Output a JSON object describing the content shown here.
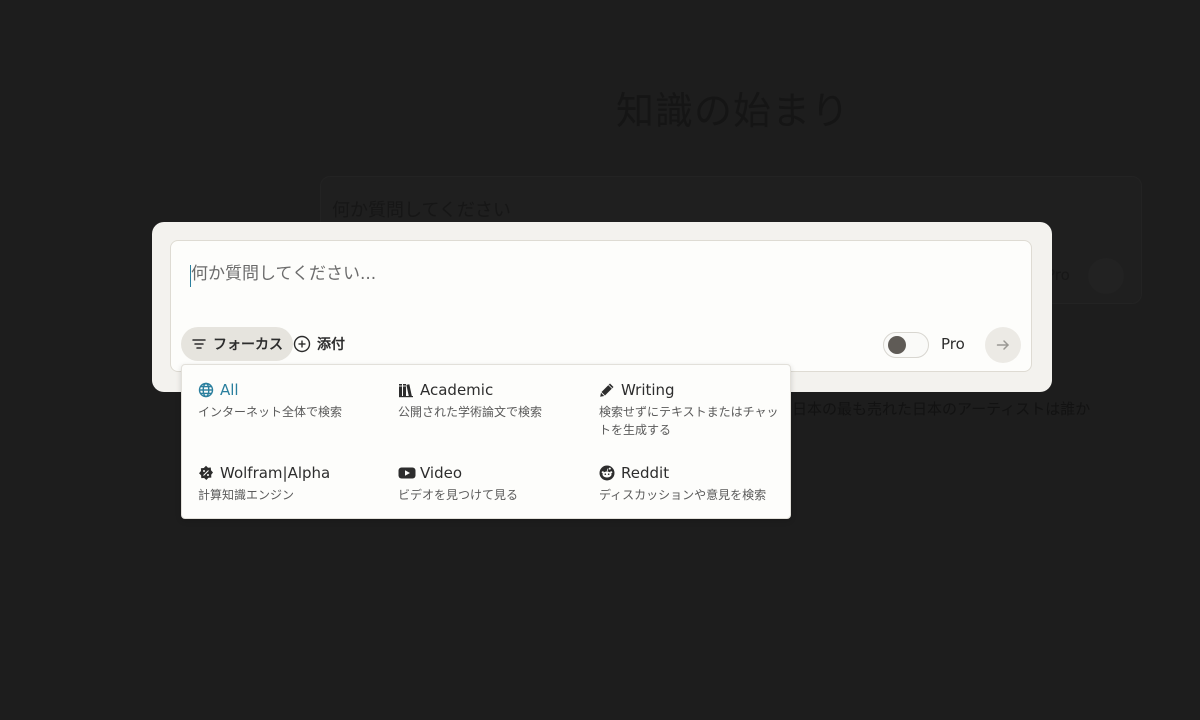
{
  "background": {
    "title": "知識の始まり",
    "placeholder": "何か質問してください",
    "pro_label": "Pro",
    "suggestion": "日本の最も売れた日本のアーティストは誰か"
  },
  "search": {
    "placeholder": "何か質問してください...",
    "value": ""
  },
  "toolbar": {
    "focus_label": "フォーカス",
    "attach_label": "添付",
    "pro_label": "Pro",
    "pro_enabled": false
  },
  "focus_menu": {
    "options": [
      {
        "label": "All",
        "description": "インターネット全体で検索",
        "icon": "globe-icon",
        "selected": true
      },
      {
        "label": "Academic",
        "description": "公開された学術論文で検索",
        "icon": "books-icon",
        "selected": false
      },
      {
        "label": "Writing",
        "description": "検索せずにテキストまたはチャットを生成する",
        "icon": "pencil-icon",
        "selected": false
      },
      {
        "label": "Wolfram|Alpha",
        "description": "計算知識エンジン",
        "icon": "wolfram-icon",
        "selected": false
      },
      {
        "label": "Video",
        "description": "ビデオを見つけて見る",
        "icon": "youtube-icon",
        "selected": false
      },
      {
        "label": "Reddit",
        "description": "ディスカッションや意見を検索",
        "icon": "reddit-icon",
        "selected": false
      }
    ]
  },
  "colors": {
    "accent": "#2a7f9e",
    "overlay": "#1d1d1d",
    "panel": "#f3f2ee"
  }
}
